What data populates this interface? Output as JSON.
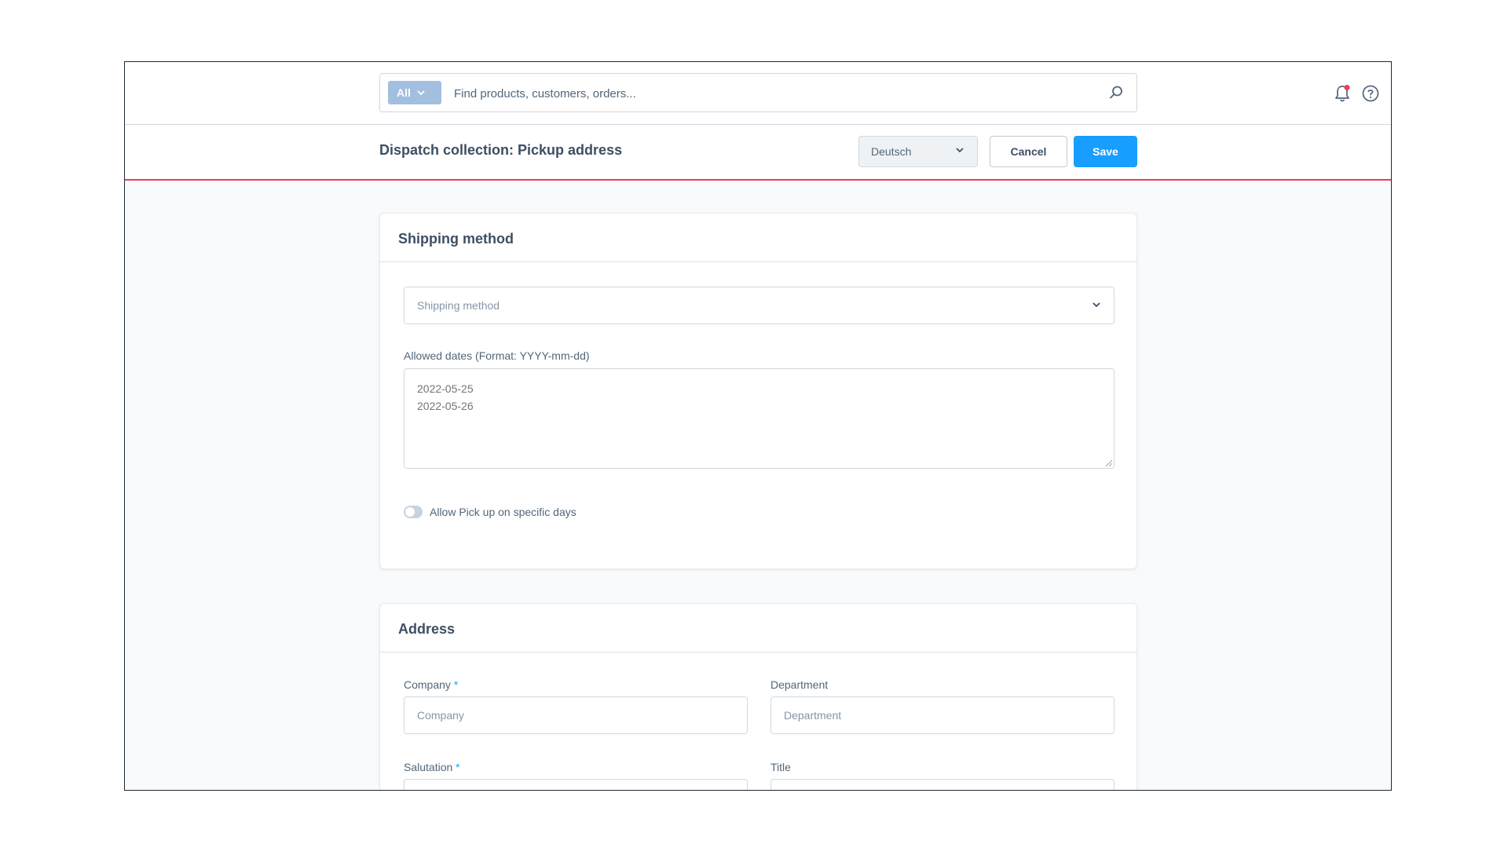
{
  "search": {
    "type_label": "All",
    "placeholder": "Find products, customers, orders..."
  },
  "icons": {
    "search": "search-icon",
    "notifications": "bell-icon",
    "help": "help-circle-icon",
    "chevron": "chevron-down-icon"
  },
  "notifications": {
    "has_unread": true,
    "badge_color": "#e83e5b"
  },
  "header": {
    "title": "Dispatch collection: Pickup address",
    "language": "Deutsch",
    "cancel_label": "Cancel",
    "save_label": "Save"
  },
  "colors": {
    "accent": "#189eff",
    "header_underline": "#e83e5b",
    "search_type_bg": "#a3bfe0"
  },
  "shipping_card": {
    "title": "Shipping method",
    "select_placeholder": "Shipping method",
    "dates_label": "Allowed dates (Format: YYYY-mm-dd)",
    "dates_placeholder": "2022-05-25\n2022-05-26",
    "toggle_label": "Allow Pick up on specific days",
    "toggle_on": false
  },
  "address_card": {
    "title": "Address",
    "company_label": "Company",
    "company_placeholder": "Company",
    "department_label": "Department",
    "department_placeholder": "Department",
    "salutation_label": "Salutation",
    "title_label": "Title",
    "required_marker": "*"
  }
}
